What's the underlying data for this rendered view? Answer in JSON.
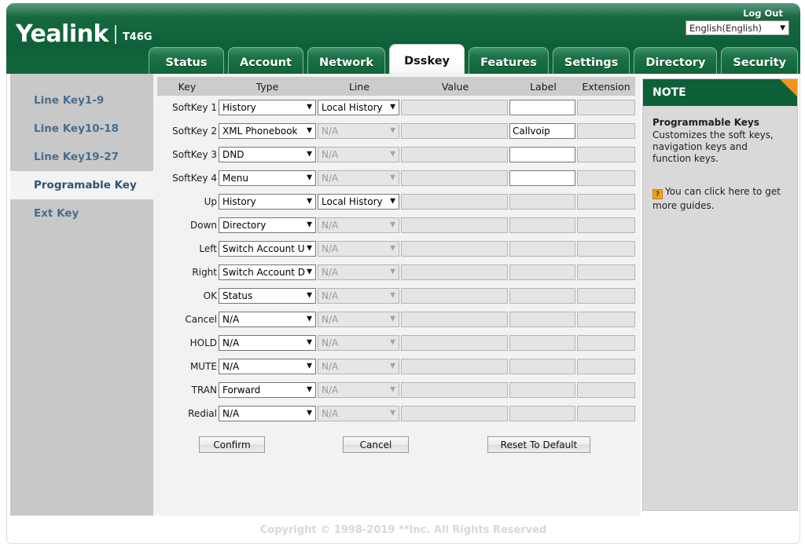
{
  "header": {
    "brand": "Yealink",
    "model": "T46G",
    "logout_label": "Log Out",
    "language": {
      "selected": "English(English)",
      "caret": "▼"
    },
    "brand_color": "#0d6038",
    "accent_color": "#f0941e"
  },
  "tabs": [
    {
      "label": "Status",
      "active": false
    },
    {
      "label": "Account",
      "active": false
    },
    {
      "label": "Network",
      "active": false
    },
    {
      "label": "Dsskey",
      "active": true
    },
    {
      "label": "Features",
      "active": false
    },
    {
      "label": "Settings",
      "active": false
    },
    {
      "label": "Directory",
      "active": false
    },
    {
      "label": "Security",
      "active": false
    }
  ],
  "sidebar": {
    "items": [
      {
        "label": "Line Key1-9",
        "active": false
      },
      {
        "label": "Line Key10-18",
        "active": false
      },
      {
        "label": "Line Key19-27",
        "active": false
      },
      {
        "label": "Programable Key",
        "active": true
      },
      {
        "label": "Ext Key",
        "active": false
      }
    ]
  },
  "table": {
    "columns": [
      "Key",
      "Type",
      "Line",
      "Value",
      "Label",
      "Extension"
    ],
    "rows": [
      {
        "key": "SoftKey 1",
        "type": "History",
        "type_disabled": false,
        "line": "Local History",
        "line_disabled": false,
        "value": "",
        "value_disabled": true,
        "label": "",
        "label_disabled": false,
        "extension": "",
        "extension_disabled": true
      },
      {
        "key": "SoftKey 2",
        "type": "XML Phonebook",
        "type_disabled": false,
        "line": "N/A",
        "line_disabled": true,
        "value": "",
        "value_disabled": true,
        "label": "Callvoip",
        "label_disabled": false,
        "extension": "",
        "extension_disabled": true
      },
      {
        "key": "SoftKey 3",
        "type": "DND",
        "type_disabled": false,
        "line": "N/A",
        "line_disabled": true,
        "value": "",
        "value_disabled": true,
        "label": "",
        "label_disabled": false,
        "extension": "",
        "extension_disabled": true
      },
      {
        "key": "SoftKey 4",
        "type": "Menu",
        "type_disabled": false,
        "line": "N/A",
        "line_disabled": true,
        "value": "",
        "value_disabled": true,
        "label": "",
        "label_disabled": false,
        "extension": "",
        "extension_disabled": true
      },
      {
        "key": "Up",
        "type": "History",
        "type_disabled": false,
        "line": "Local History",
        "line_disabled": false,
        "value": "",
        "value_disabled": true,
        "label": "",
        "label_disabled": true,
        "extension": "",
        "extension_disabled": true
      },
      {
        "key": "Down",
        "type": "Directory",
        "type_disabled": false,
        "line": "N/A",
        "line_disabled": true,
        "value": "",
        "value_disabled": true,
        "label": "",
        "label_disabled": true,
        "extension": "",
        "extension_disabled": true
      },
      {
        "key": "Left",
        "type": "Switch Account U",
        "type_disabled": false,
        "line": "N/A",
        "line_disabled": true,
        "value": "",
        "value_disabled": true,
        "label": "",
        "label_disabled": true,
        "extension": "",
        "extension_disabled": true
      },
      {
        "key": "Right",
        "type": "Switch Account D",
        "type_disabled": false,
        "line": "N/A",
        "line_disabled": true,
        "value": "",
        "value_disabled": true,
        "label": "",
        "label_disabled": true,
        "extension": "",
        "extension_disabled": true
      },
      {
        "key": "OK",
        "type": "Status",
        "type_disabled": false,
        "line": "N/A",
        "line_disabled": true,
        "value": "",
        "value_disabled": true,
        "label": "",
        "label_disabled": true,
        "extension": "",
        "extension_disabled": true
      },
      {
        "key": "Cancel",
        "type": "N/A",
        "type_disabled": false,
        "line": "N/A",
        "line_disabled": true,
        "value": "",
        "value_disabled": true,
        "label": "",
        "label_disabled": true,
        "extension": "",
        "extension_disabled": true
      },
      {
        "key": "HOLD",
        "type": "N/A",
        "type_disabled": false,
        "line": "N/A",
        "line_disabled": true,
        "value": "",
        "value_disabled": true,
        "label": "",
        "label_disabled": true,
        "extension": "",
        "extension_disabled": true
      },
      {
        "key": "MUTE",
        "type": "N/A",
        "type_disabled": false,
        "line": "N/A",
        "line_disabled": true,
        "value": "",
        "value_disabled": true,
        "label": "",
        "label_disabled": true,
        "extension": "",
        "extension_disabled": true
      },
      {
        "key": "TRAN",
        "type": "Forward",
        "type_disabled": false,
        "line": "N/A",
        "line_disabled": true,
        "value": "",
        "value_disabled": true,
        "label": "",
        "label_disabled": true,
        "extension": "",
        "extension_disabled": true
      },
      {
        "key": "Redial",
        "type": "N/A",
        "type_disabled": false,
        "line": "N/A",
        "line_disabled": true,
        "value": "",
        "value_disabled": true,
        "label": "",
        "label_disabled": true,
        "extension": "",
        "extension_disabled": true
      }
    ],
    "caret": "▼"
  },
  "buttons": {
    "confirm": "Confirm",
    "cancel": "Cancel",
    "reset": "Reset To Default"
  },
  "note": {
    "header": "NOTE",
    "title": "Programmable Keys",
    "text": "Customizes the soft keys, navigation keys and function keys.",
    "help_glyph": "?",
    "link_text": "You can click here to get more guides."
  },
  "footer": {
    "copyright": "Copyright © 1998-2019 **Inc. All Rights Reserved"
  }
}
